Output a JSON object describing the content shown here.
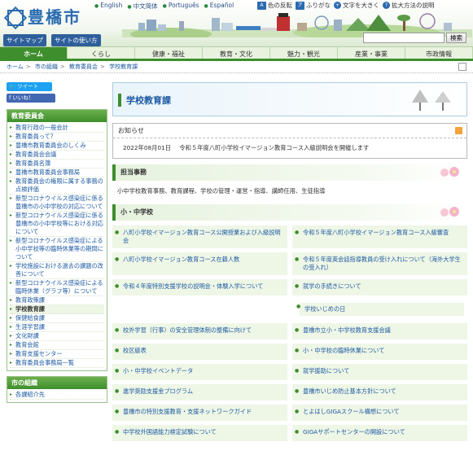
{
  "header": {
    "logo_text": "豊橋市",
    "languages": [
      "English",
      "中文简体",
      "Português",
      "Español"
    ],
    "tools": {
      "color_reverse": "色の反転",
      "furigana": "ふりがな",
      "text_bigger": "文字を大きく",
      "zoom_method": "拡大方法の説明"
    },
    "sitemap_label": "サイトマップ",
    "how_to_use_label": "サイトの使い方",
    "search_placeholder": "",
    "search_button": "検索"
  },
  "gnav": [
    "ホーム",
    "くらし",
    "健康・福祉",
    "教育・文化",
    "魅力・観光",
    "産業・事業",
    "市政情報"
  ],
  "breadcrumb": [
    "ホーム",
    "市の組織",
    "教育委員会",
    "学校教育課"
  ],
  "sidebar": {
    "tweet": "ツイート",
    "like": "いいね！",
    "box1_title": "教育委員会",
    "box1_items": [
      "教育行政の一般会計",
      "教育委員って？",
      "豊橋市教育委員会のしくみ",
      "教育委員会会議",
      "教育委員名簿",
      "豊橋市教育委員会事務局",
      "教育委員会の権限に属する事務の点検評価",
      "新型コロナウイルス感染症に係る豊橋市の小中学校の対応について",
      "新型コロナウイルス感染症に係る豊橋市の小中学校等における対応について",
      "新型コロナウイルス感染症による小中学校等の臨時休業等の期間について",
      "学校施設における過去の課題の改善について",
      "新型コロナウイルス感染症による臨時休業（グラフ等）について",
      "教育政策課",
      "学校教育課",
      "保健給食課",
      "生涯学習課",
      "文化財課",
      "教育会館",
      "教育支援センター",
      "教育委員会事務局一覧"
    ],
    "box2_title": "市の組織",
    "box2_items": [
      "各課紹介先"
    ]
  },
  "main": {
    "title": "学校教育課",
    "notice_title": "お知らせ",
    "notice_date": "2022年08月01日",
    "notice_text": "令和５年度八町小学校イマージョン教育コース入級説明会を開催します",
    "duties_title": "担当事務",
    "duties_text": "小中学校教育事務、教育課程、学校の管理・運営・指導、講師任用、生徒指導",
    "school_section_title": "小・中学校",
    "links": [
      "八町小学校イマージョン教育コース公開授業および入級説明会",
      "令和５年度八町小学校イマージョン教育コース入級審査",
      "八町小学校イマージョン教育コース在籍人数",
      "令和５年度英会話指導教員の受け入れについて（海外大学生の受入れ）",
      "令和４年度特別支援学校の説明会・体験入学について",
      "就学の手続きについて",
      "学校いじめの日",
      "校外学習（行事）の安全管理体制の整備に向けて",
      "豊橋市立小・中学校教育支援会議",
      "校区級表",
      "小・中学校の臨時休業について",
      "小・中学校イベントデータ",
      "就学援助について",
      "進学奨励支援金プログラム",
      "豊橋市いじめ防止基本方針について",
      "豊橋市の特別支援教育・支援ネットワークガイド",
      "とよはしGIGAスクール構想について",
      "中学校外国語能力検定試験について",
      "GIGAサポートセンターの開設について"
    ]
  }
}
